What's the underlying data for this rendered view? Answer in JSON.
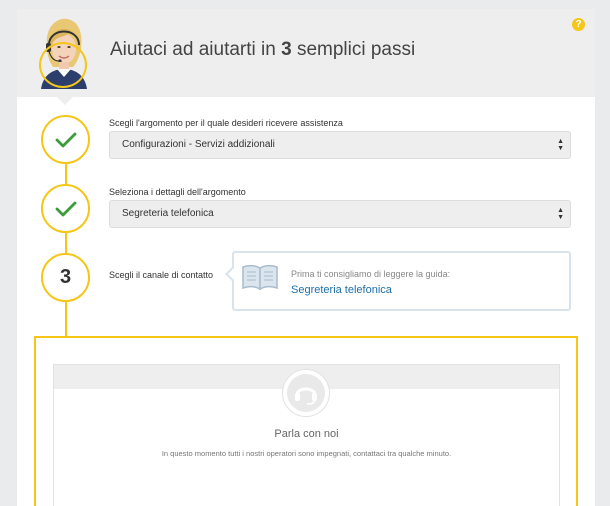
{
  "header": {
    "title_prefix": "Aiutaci ad aiutarti in ",
    "title_number": "3",
    "title_suffix": " semplici passi",
    "help_icon_label": "?"
  },
  "steps": [
    {
      "status": "done",
      "label": "Scegli l'argomento per il quale desideri ricevere assistenza",
      "select_value": "Configurazioni - Servizi addizionali"
    },
    {
      "status": "done",
      "label": "Seleziona i dettagli dell'argomento",
      "select_value": "Segreteria telefonica"
    },
    {
      "status": "current",
      "number": "3",
      "label": "Scegli il canale di contatto"
    }
  ],
  "guide": {
    "intro": "Prima ti consigliamo di leggere la guida:",
    "link": "Segreteria telefonica"
  },
  "contact": {
    "title": "Parla con noi",
    "message": "In questo momento tutti i nostri operatori sono impegnati, contattaci tra qualche minuto."
  },
  "colors": {
    "accent": "#f5c518",
    "link": "#1e6fa8",
    "check": "#3a9d3a",
    "header_bg": "#eeeeee"
  }
}
